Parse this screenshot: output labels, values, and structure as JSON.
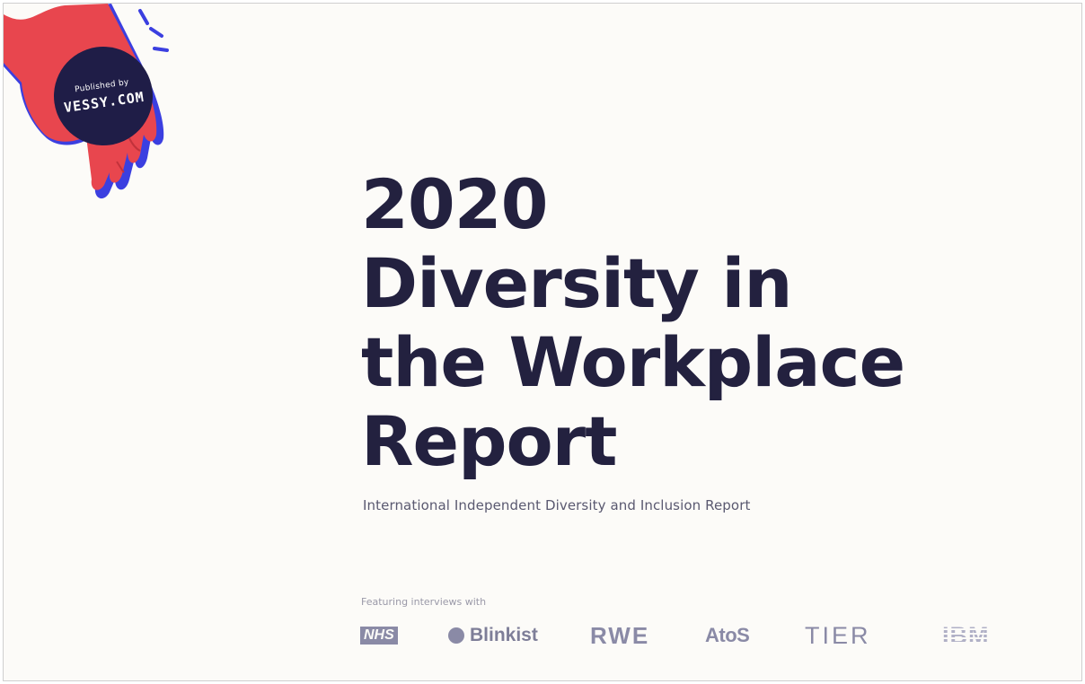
{
  "badge": {
    "line1": "Published by",
    "line2": "VESSY.COM"
  },
  "title": {
    "line1": "2020",
    "line2": "Diversity in",
    "line3": "the Workplace",
    "line4": "Report"
  },
  "subtitle": "International Independent Diversity and Inclusion Report",
  "featuring_label": "Featuring interviews with",
  "logos": [
    "NHS",
    "Blinkist",
    "RWE",
    "AtoS",
    "TIER",
    "IBM"
  ],
  "colors": {
    "background": "#fcfbf8",
    "title": "#23213f",
    "hand": "#e8464e",
    "hand_shadow": "#3b3fe0",
    "badge": "#1f1d47",
    "logo_gray": "#8a8aa6"
  }
}
